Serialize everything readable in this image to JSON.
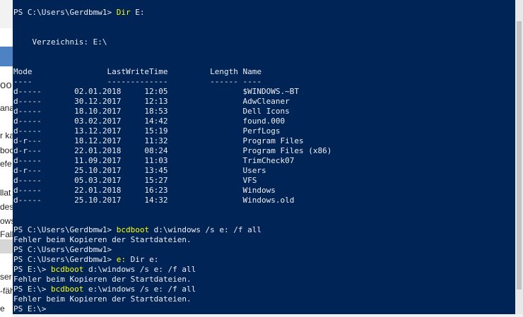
{
  "background_window": {
    "fragments": [
      "oo",
      "ana",
      "r ka",
      "boo",
      "efe",
      "llat",
      "des",
      "ows",
      "Fall",
      "ser",
      "-fäh",
      "e"
    ]
  },
  "console": {
    "lines": [
      {
        "segments": [
          {
            "text": "PS C:\\Users\\Gerdbmw1> ",
            "style": "normal"
          },
          {
            "text": "Dir",
            "style": "cmd"
          },
          {
            "text": " E:",
            "style": "normal"
          }
        ]
      },
      {
        "segments": [
          {
            "text": "",
            "style": "normal"
          }
        ]
      },
      {
        "segments": [
          {
            "text": "",
            "style": "normal"
          }
        ]
      },
      {
        "segments": [
          {
            "text": "    Verzeichnis: E:\\",
            "style": "normal"
          }
        ]
      },
      {
        "segments": [
          {
            "text": "",
            "style": "normal"
          }
        ]
      },
      {
        "segments": [
          {
            "text": "",
            "style": "normal"
          }
        ]
      },
      {
        "segments": [
          {
            "text": "Mode                LastWriteTime         Length Name",
            "style": "normal"
          }
        ]
      },
      {
        "segments": [
          {
            "text": "----                -------------         ------ ----",
            "style": "normal"
          }
        ]
      },
      {
        "segments": [
          {
            "text": "d-----       02.01.2018     12:05                $WINDOWS.~BT",
            "style": "normal"
          }
        ]
      },
      {
        "segments": [
          {
            "text": "d-----       30.12.2017     12:13                AdwCleaner",
            "style": "normal"
          }
        ]
      },
      {
        "segments": [
          {
            "text": "d-----       18.10.2017     18:53                Dell Icons",
            "style": "normal"
          }
        ]
      },
      {
        "segments": [
          {
            "text": "d-----       03.02.2017     14:42                found.000",
            "style": "normal"
          }
        ]
      },
      {
        "segments": [
          {
            "text": "d-----       13.12.2017     15:19                PerfLogs",
            "style": "normal"
          }
        ]
      },
      {
        "segments": [
          {
            "text": "d-r---       18.12.2017     11:32                Program Files",
            "style": "normal"
          }
        ]
      },
      {
        "segments": [
          {
            "text": "d-r---       22.01.2018     08:24                Program Files (x86)",
            "style": "normal"
          }
        ]
      },
      {
        "segments": [
          {
            "text": "d-----       11.09.2017     11:03                TrimCheck07",
            "style": "normal"
          }
        ]
      },
      {
        "segments": [
          {
            "text": "d-r---       25.10.2017     13:45                Users",
            "style": "normal"
          }
        ]
      },
      {
        "segments": [
          {
            "text": "d-----       05.03.2017     15:27                VFS",
            "style": "normal"
          }
        ]
      },
      {
        "segments": [
          {
            "text": "d-----       22.01.2018     16:23                Windows",
            "style": "normal"
          }
        ]
      },
      {
        "segments": [
          {
            "text": "d-----       25.10.2017     14:32                Windows.old",
            "style": "normal"
          }
        ]
      },
      {
        "segments": [
          {
            "text": "",
            "style": "normal"
          }
        ]
      },
      {
        "segments": [
          {
            "text": "",
            "style": "normal"
          }
        ]
      },
      {
        "segments": [
          {
            "text": "PS C:\\Users\\Gerdbmw1> ",
            "style": "normal"
          },
          {
            "text": "bcdboot",
            "style": "cmd"
          },
          {
            "text": " d:\\windows /s e: /f all",
            "style": "normal"
          }
        ]
      },
      {
        "segments": [
          {
            "text": "Fehler beim Kopieren der Startdateien.",
            "style": "normal"
          }
        ]
      },
      {
        "segments": [
          {
            "text": "PS C:\\Users\\Gerdbmw1>",
            "style": "normal"
          }
        ]
      },
      {
        "segments": [
          {
            "text": "PS C:\\Users\\Gerdbmw1> ",
            "style": "normal"
          },
          {
            "text": "e:",
            "style": "cmd"
          },
          {
            "text": " Dir e:",
            "style": "normal"
          }
        ]
      },
      {
        "segments": [
          {
            "text": "PS E:\\> ",
            "style": "normal"
          },
          {
            "text": "bcdboot",
            "style": "cmd"
          },
          {
            "text": " d:\\windows /s e: /f all",
            "style": "normal"
          }
        ]
      },
      {
        "segments": [
          {
            "text": "Fehler beim Kopieren der Startdateien.",
            "style": "normal"
          }
        ]
      },
      {
        "segments": [
          {
            "text": "PS E:\\> ",
            "style": "normal"
          },
          {
            "text": "bcdboot",
            "style": "cmd"
          },
          {
            "text": " e:\\windows /s e: /f all",
            "style": "normal"
          }
        ]
      },
      {
        "segments": [
          {
            "text": "Fehler beim Kopieren der Startdateien.",
            "style": "normal"
          }
        ]
      },
      {
        "segments": [
          {
            "text": "PS E:\\>",
            "style": "normal"
          }
        ]
      }
    ]
  },
  "colors": {
    "console_background": "#012456",
    "console_text": "#eeedf0",
    "command_text": "#ffff00"
  }
}
